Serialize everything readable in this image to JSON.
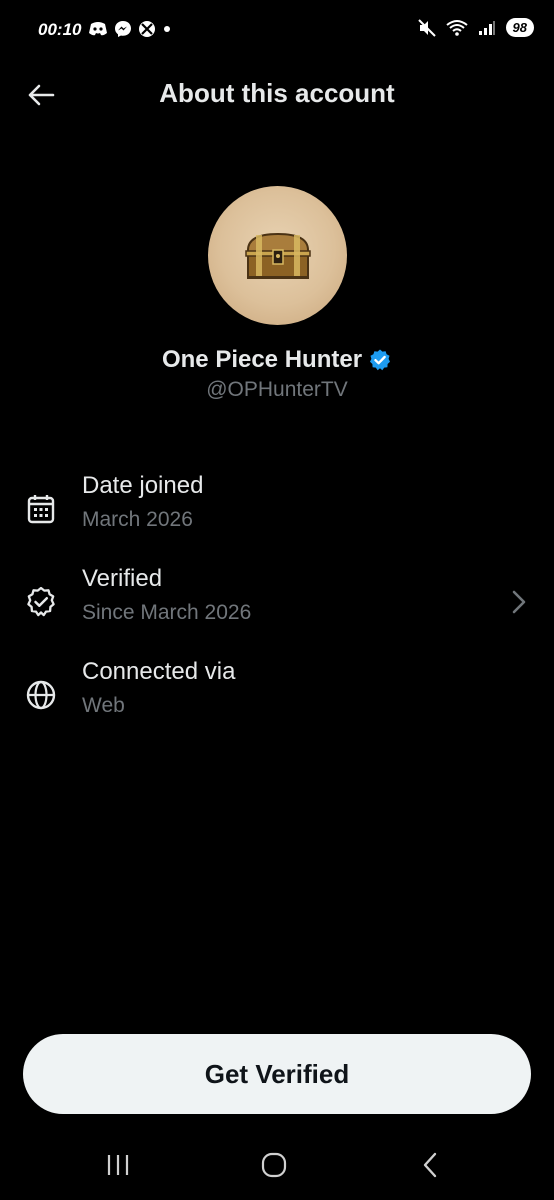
{
  "status_bar": {
    "time": "00:10",
    "battery": "98",
    "left_icons": [
      "discord-icon",
      "messenger-icon",
      "xbox-icon",
      "dot-icon"
    ],
    "right_icons": [
      "mute-icon",
      "wifi-icon",
      "signal-icon"
    ]
  },
  "header": {
    "title": "About this account"
  },
  "profile": {
    "name": "One Piece Hunter",
    "handle": "@OPHunterTV",
    "verified_color": "#1d9bf0"
  },
  "info": [
    {
      "label": "Date joined",
      "value": "March 2026",
      "icon": "calendar-icon"
    },
    {
      "label": "Verified",
      "value": "Since March 2026",
      "icon": "verified-badge-icon"
    },
    {
      "label": "Connected via",
      "value": "Web",
      "icon": "globe-icon"
    }
  ],
  "cta": {
    "label": "Get Verified"
  },
  "colors": {
    "background": "#000000",
    "primary_text": "#e7e9ea",
    "secondary_text": "#71767b",
    "button_bg": "#eff3f4"
  }
}
